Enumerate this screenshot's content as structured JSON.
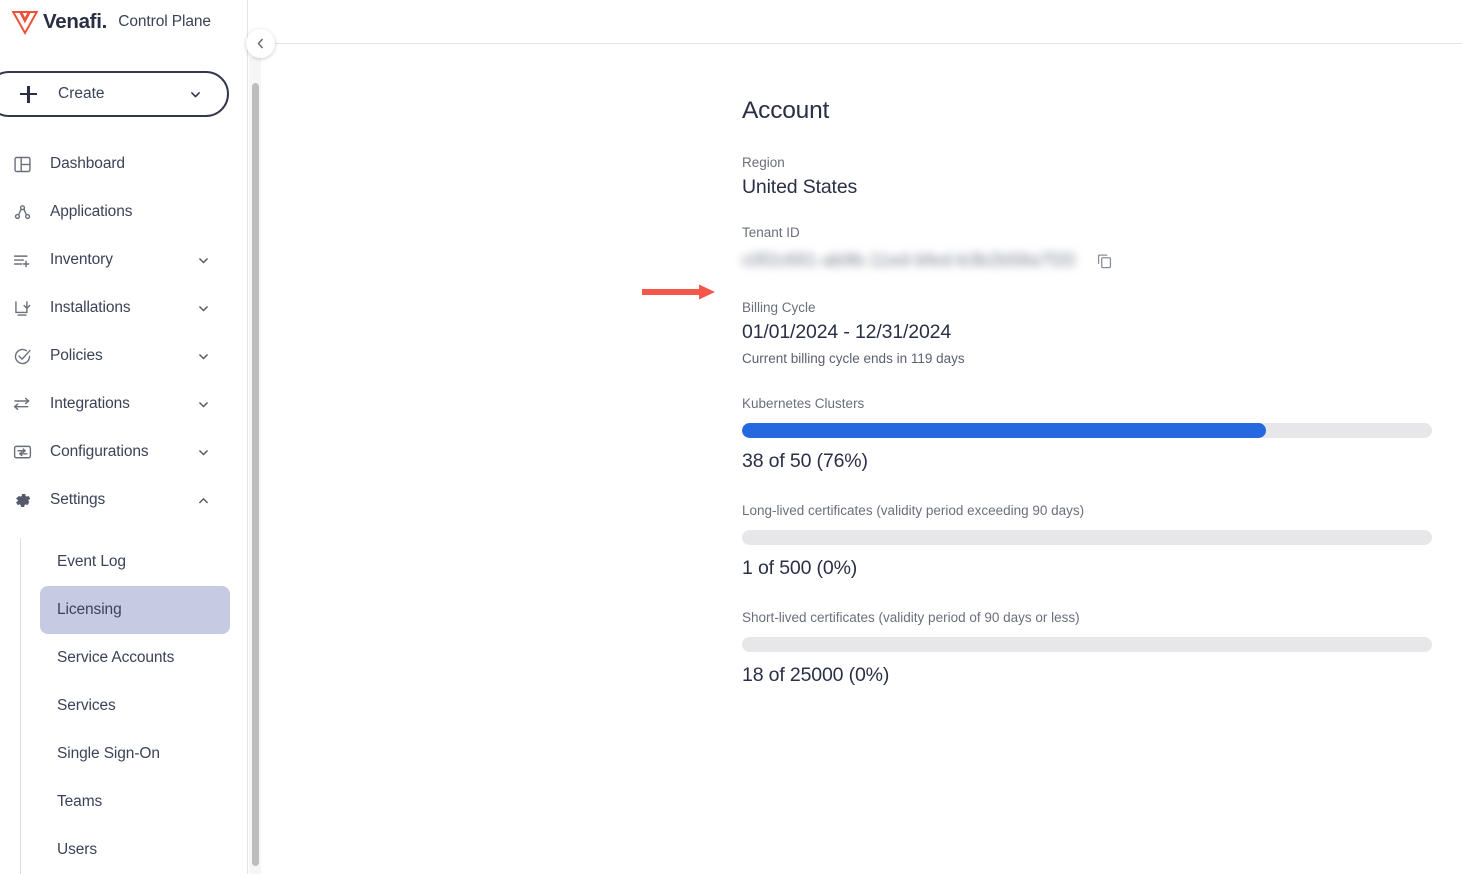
{
  "brand": {
    "wordmark": "Venafi",
    "dot": ".",
    "product": "Control Plane",
    "logo_icon": "venafi-v-logo",
    "logo_color": "#ed5338"
  },
  "sidebar": {
    "create_button": {
      "label": "Create",
      "plus_icon": "plus-icon",
      "chevron_icon": "chevron-down-icon"
    },
    "collapse_button": {
      "icon": "chevron-left-icon"
    },
    "nav_items": [
      {
        "label": "Dashboard",
        "icon": "dashboard-layout-icon",
        "expandable": false,
        "expanded": false,
        "active": false
      },
      {
        "label": "Applications",
        "icon": "applications-nodes-icon",
        "expandable": false,
        "expanded": false,
        "active": false
      },
      {
        "label": "Inventory",
        "icon": "inventory-list-add-icon",
        "expandable": true,
        "expanded": false,
        "active": false
      },
      {
        "label": "Installations",
        "icon": "installations-download-icon",
        "expandable": true,
        "expanded": false,
        "active": false
      },
      {
        "label": "Policies",
        "icon": "policies-check-circle-icon",
        "expandable": true,
        "expanded": false,
        "active": false
      },
      {
        "label": "Integrations",
        "icon": "integrations-arrows-icon",
        "expandable": true,
        "expanded": false,
        "active": false
      },
      {
        "label": "Configurations",
        "icon": "configurations-monitor-icon",
        "expandable": true,
        "expanded": false,
        "active": false
      },
      {
        "label": "Settings",
        "icon": "settings-gear-icon",
        "expandable": true,
        "expanded": true,
        "active": true
      }
    ],
    "sub_items": [
      {
        "label": "Event Log",
        "active": false
      },
      {
        "label": "Licensing",
        "active": true
      },
      {
        "label": "Service Accounts",
        "active": false
      },
      {
        "label": "Services",
        "active": false
      },
      {
        "label": "Single Sign-On",
        "active": false
      },
      {
        "label": "Teams",
        "active": false
      },
      {
        "label": "Users",
        "active": false
      }
    ],
    "active_sub_bg": "#c6cbe3"
  },
  "main": {
    "page_title": "Account",
    "region": {
      "label": "Region",
      "value": "United States"
    },
    "tenant": {
      "label": "Tenant ID",
      "value": "c0f2c691-ab9b-11ed-bfed-b3b2b58a7f20",
      "redacted": true,
      "copy_icon": "copy-icon"
    },
    "billing": {
      "label": "Billing Cycle",
      "value": "01/01/2024 - 12/31/2024",
      "note": "Current billing cycle ends in 119 days"
    },
    "meters": [
      {
        "label": "Kubernetes Clusters",
        "used": 38,
        "total": 50,
        "percent": 76,
        "value_text": "38 of 50 (76%)",
        "fill_color": "#2568e0",
        "track_color": "#e7e7ea"
      },
      {
        "label": "Long-lived certificates (validity period exceeding 90 days)",
        "used": 1,
        "total": 500,
        "percent": 0,
        "value_text": "1 of 500 (0%)",
        "fill_color": "#2568e0",
        "track_color": "#e7e7ea"
      },
      {
        "label": "Short-lived certificates (validity period of 90 days or less)",
        "used": 18,
        "total": 25000,
        "percent": 0,
        "value_text": "18 of 25000 (0%)",
        "fill_color": "#2568e0",
        "track_color": "#e7e7ea"
      }
    ]
  },
  "annotation": {
    "arrow_icon": "red-arrow-right-annotation",
    "color": "#f4564a"
  }
}
